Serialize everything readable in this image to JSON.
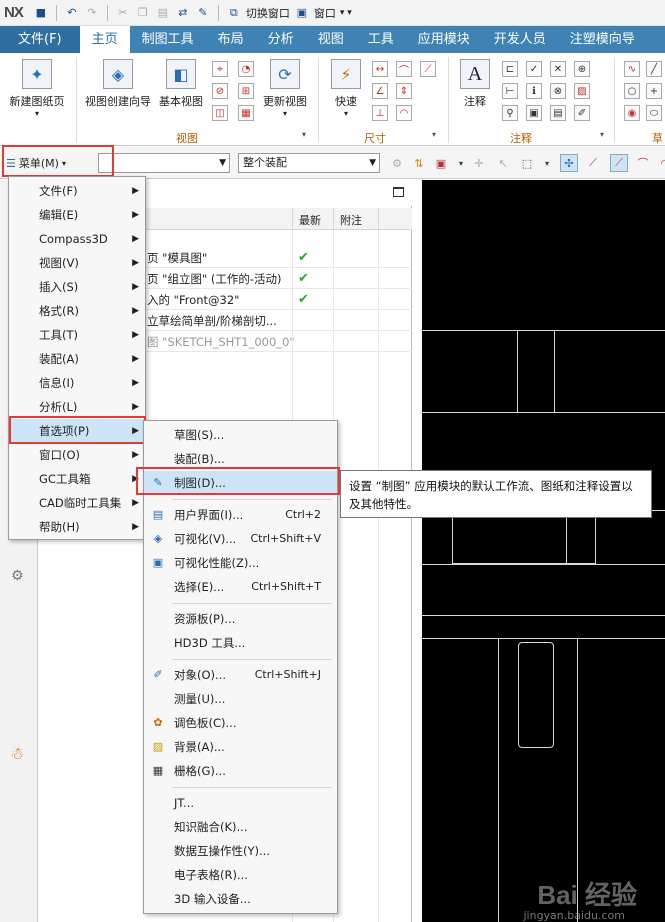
{
  "app": {
    "logo": "NX"
  },
  "quickaccess": {
    "switch_window": "切换窗口",
    "window": "窗口"
  },
  "ribbon_tabs": [
    "文件(F)",
    "主页",
    "制图工具",
    "布局",
    "分析",
    "视图",
    "工具",
    "应用模块",
    "开发人员",
    "注塑模向导"
  ],
  "ribbon": {
    "new_sheet": "新建图纸页",
    "view_wizard": "视图创建向导",
    "base_view": "基本视图",
    "update_view": "更新视图",
    "quick": "快速",
    "annotation": "注释",
    "group_view": "视图",
    "group_dim": "尺寸",
    "group_note": "注释",
    "group_cut": "草"
  },
  "toolbar": {
    "menu_label": "菜单(M)",
    "combo1": "",
    "combo2": "整个装配"
  },
  "navigator": {
    "col_latest": "最新",
    "col_note": "附注",
    "rows": [
      {
        "text": "页 \"模具图\"",
        "check": "✔"
      },
      {
        "text": "页 \"组立图\" (工作的-活动)",
        "check": "✔"
      },
      {
        "text": "入的 \"Front@32\"",
        "check": "✔"
      },
      {
        "text": "立草绘简单剖/阶梯剖切...",
        "check": ""
      },
      {
        "text": "图 \"SKETCH_SHT1_000_0\"",
        "check": ""
      }
    ]
  },
  "main_menu": [
    {
      "label": "文件(F)"
    },
    {
      "label": "编辑(E)"
    },
    {
      "label": "Compass3D"
    },
    {
      "label": "视图(V)"
    },
    {
      "label": "插入(S)"
    },
    {
      "label": "格式(R)"
    },
    {
      "label": "工具(T)"
    },
    {
      "label": "装配(A)"
    },
    {
      "label": "信息(I)"
    },
    {
      "label": "分析(L)"
    },
    {
      "label": "首选项(P)"
    },
    {
      "label": "窗口(O)"
    },
    {
      "label": "GC工具箱"
    },
    {
      "label": "CAD临时工具集"
    },
    {
      "label": "帮助(H)"
    }
  ],
  "pref_menu": [
    {
      "label": "草图(S)...",
      "shortcut": ""
    },
    {
      "label": "装配(B)...",
      "shortcut": ""
    },
    {
      "label": "制图(D)...",
      "shortcut": ""
    },
    {
      "label": "用户界面(I)...",
      "shortcut": "Ctrl+2"
    },
    {
      "label": "可视化(V)...",
      "shortcut": "Ctrl+Shift+V"
    },
    {
      "label": "可视化性能(Z)...",
      "shortcut": ""
    },
    {
      "label": "选择(E)...",
      "shortcut": "Ctrl+Shift+T"
    },
    {
      "label": "资源板(P)...",
      "shortcut": ""
    },
    {
      "label": "HD3D 工具...",
      "shortcut": ""
    },
    {
      "label": "对象(O)...",
      "shortcut": "Ctrl+Shift+J"
    },
    {
      "label": "测量(U)...",
      "shortcut": ""
    },
    {
      "label": "调色板(C)...",
      "shortcut": ""
    },
    {
      "label": "背景(A)...",
      "shortcut": ""
    },
    {
      "label": "栅格(G)...",
      "shortcut": ""
    },
    {
      "label": "JT...",
      "shortcut": ""
    },
    {
      "label": "知识融合(K)...",
      "shortcut": ""
    },
    {
      "label": "数据互操作性(Y)...",
      "shortcut": ""
    },
    {
      "label": "电子表格(R)...",
      "shortcut": ""
    },
    {
      "label": "3D 输入设备...",
      "shortcut": ""
    }
  ],
  "tooltip": "设置 “制图” 应用模块的默认工作流、图纸和注释设置以及其他特性。",
  "watermark": {
    "main": "Bai 经验",
    "sub": "jingyan.baidu.com"
  },
  "colors": {
    "accent": "#3f83b5",
    "highlight_box": "#e53935",
    "menu_highlight": "#cde4f6"
  }
}
